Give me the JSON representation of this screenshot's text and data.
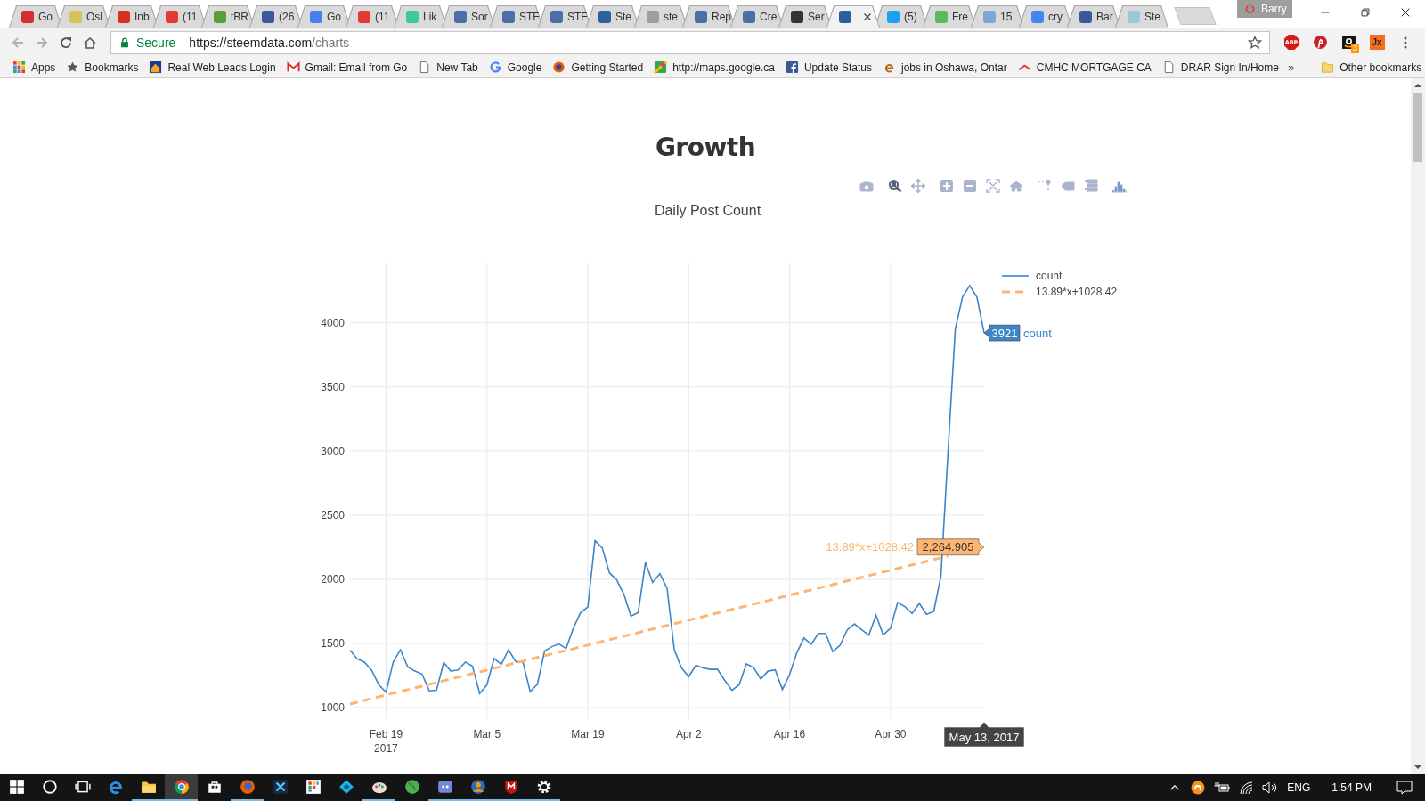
{
  "browser": {
    "tabs": [
      {
        "label": "Go",
        "color": "#d32f2f",
        "selected": false
      },
      {
        "label": "Osl",
        "color": "#d8c25a",
        "selected": false
      },
      {
        "label": "Inb",
        "color": "#d93025",
        "selected": false
      },
      {
        "label": "(11",
        "color": "#e53935",
        "selected": false
      },
      {
        "label": "tBR",
        "color": "#5a9e3a",
        "selected": false
      },
      {
        "label": "(26",
        "color": "#3b5998",
        "selected": false
      },
      {
        "label": "Go",
        "color": "#4a7ef0",
        "selected": false
      },
      {
        "label": "(11",
        "color": "#e53935",
        "selected": false
      },
      {
        "label": "Lik",
        "color": "#3cc8a0",
        "selected": false
      },
      {
        "label": "Sor",
        "color": "#4a6fa5",
        "selected": false
      },
      {
        "label": "STE",
        "color": "#4a6fa5",
        "selected": false
      },
      {
        "label": "STE",
        "color": "#4a6fa5",
        "selected": false
      },
      {
        "label": "Ste",
        "color": "#2c5f9e",
        "selected": false
      },
      {
        "label": "ste",
        "color": "#9e9e9e",
        "selected": false
      },
      {
        "label": "Rep",
        "color": "#4a6fa5",
        "selected": false
      },
      {
        "label": "Cre",
        "color": "#4a6fa5",
        "selected": false
      },
      {
        "label": "Ser",
        "color": "#333333",
        "selected": false
      },
      {
        "color": "#2c5f9e",
        "selected": true
      },
      {
        "label": "(5)",
        "color": "#1da1f2",
        "selected": false
      },
      {
        "label": "Fre",
        "color": "#5cb85c",
        "selected": false
      },
      {
        "label": "15",
        "color": "#7aa7d8",
        "selected": false
      },
      {
        "label": "cry",
        "color": "#4285f4",
        "selected": false
      },
      {
        "label": "Bar",
        "color": "#3b5998",
        "selected": false
      },
      {
        "label": "Ste",
        "color": "#9cc9d9",
        "selected": false
      }
    ],
    "profile": {
      "name": "Barry"
    },
    "address": {
      "secure_label": "Secure",
      "url_host": "https://steemdata.com",
      "url_path": "/charts"
    },
    "extensions": [
      {
        "kind": "abp",
        "text": "ABP"
      },
      {
        "kind": "pinterest"
      },
      {
        "kind": "amazon",
        "badge": "3"
      },
      {
        "kind": "jx",
        "text": "Jx"
      }
    ],
    "bookmarks": [
      {
        "kind": "apps",
        "label": "Apps"
      },
      {
        "kind": "star",
        "label": "Bookmarks"
      },
      {
        "kind": "house",
        "label": "Real Web Leads Login"
      },
      {
        "kind": "gmail",
        "label": "Gmail: Email from Go"
      },
      {
        "kind": "page",
        "label": "New Tab"
      },
      {
        "kind": "google",
        "label": "Google"
      },
      {
        "kind": "firefox",
        "label": "Getting Started"
      },
      {
        "kind": "maps",
        "label": "http://maps.google.ca"
      },
      {
        "kind": "facebook",
        "label": "Update Status"
      },
      {
        "kind": "e",
        "label": "jobs in Oshawa, Ontar"
      },
      {
        "kind": "cmhc",
        "label": "CMHC MORTGAGE CA"
      },
      {
        "kind": "page",
        "label": "DRAR Sign In/Home"
      }
    ],
    "overflow": "»",
    "other_bookmarks": "Other bookmarks"
  },
  "page": {
    "title": "Growth",
    "modebar": [
      {
        "kind": "camera",
        "selected": false
      },
      {
        "kind": "zoom",
        "selected": true
      },
      {
        "kind": "pan",
        "selected": false
      },
      {
        "kind": "zoomin",
        "selected": false
      },
      {
        "kind": "zoomout",
        "selected": false
      },
      {
        "kind": "autoscale",
        "selected": false
      },
      {
        "kind": "home",
        "selected": false
      },
      {
        "kind": "spike",
        "selected": false
      },
      {
        "kind": "closest",
        "selected": false
      },
      {
        "kind": "compare",
        "selected": false
      },
      {
        "kind": "logo",
        "selected": false
      }
    ],
    "chart_data": {
      "type": "line",
      "title": "Daily Post Count",
      "categories": [
        null,
        null,
        null,
        null,
        null,
        "Feb 19",
        null,
        null,
        null,
        null,
        null,
        null,
        null,
        null,
        null,
        null,
        null,
        null,
        null,
        "Mar 5",
        null,
        null,
        null,
        null,
        null,
        null,
        null,
        null,
        null,
        null,
        null,
        null,
        null,
        "Mar 19",
        null,
        null,
        null,
        null,
        null,
        null,
        null,
        null,
        null,
        null,
        null,
        null,
        null,
        "Apr 2",
        null,
        null,
        null,
        null,
        null,
        null,
        null,
        null,
        null,
        null,
        null,
        null,
        null,
        "Apr 16",
        null,
        null,
        null,
        null,
        null,
        null,
        null,
        null,
        null,
        null,
        null,
        null,
        null,
        "Apr 30",
        null,
        null,
        null,
        null,
        null,
        null,
        null,
        null,
        null,
        null,
        null,
        null,
        null
      ],
      "series": [
        {
          "name": "count",
          "color": "#3d85c6",
          "line_style": "solid",
          "values": [
            1447,
            1379,
            1355,
            1291,
            1177,
            1120,
            1355,
            1450,
            1319,
            1284,
            1262,
            1131,
            1135,
            1351,
            1284,
            1294,
            1355,
            1323,
            1110,
            1177,
            1383,
            1337,
            1450,
            1358,
            1355,
            1124,
            1181,
            1440,
            1475,
            1496,
            1461,
            1620,
            1741,
            1784,
            2301,
            2245,
            2050,
            1996,
            1883,
            1713,
            1741,
            2131,
            1975,
            2043,
            1929,
            1450,
            1309,
            1241,
            1330,
            1309,
            1298,
            1298,
            1213,
            1135,
            1177,
            1340,
            1312,
            1223,
            1284,
            1294,
            1142,
            1255,
            1426,
            1543,
            1493,
            1578,
            1578,
            1436,
            1486,
            1606,
            1652,
            1606,
            1564,
            1720,
            1567,
            1617,
            1819,
            1787,
            1734,
            1812,
            1727,
            1748,
            2025,
            3000,
            3950,
            4200,
            4290,
            4200,
            3921
          ]
        },
        {
          "name": "13.89*x+1028.42",
          "color": "#ffb570",
          "line_style": "dashed",
          "values": [
            1028,
            1042,
            1056,
            1070,
            1084,
            1098,
            1112,
            1126,
            1140,
            1153,
            1167,
            1181,
            1195,
            1209,
            1223,
            1237,
            1251,
            1265,
            1278,
            1292,
            1306,
            1320,
            1334,
            1348,
            1362,
            1376,
            1390,
            1404,
            1417,
            1431,
            1445,
            1459,
            1473,
            1487,
            1501,
            1515,
            1529,
            1542,
            1556,
            1570,
            1584,
            1598,
            1612,
            1626,
            1640,
            1654,
            1667,
            1681,
            1695,
            1709,
            1723,
            1737,
            1751,
            1765,
            1779,
            1792,
            1806,
            1820,
            1834,
            1848,
            1862,
            1876,
            1890,
            1904,
            1917,
            1931,
            1945,
            1959,
            1973,
            1987,
            2001,
            2015,
            2029,
            2042,
            2056,
            2070,
            2084,
            2098,
            2112,
            2126,
            2140,
            2154,
            2167,
            2181,
            null,
            null,
            null,
            null,
            null
          ]
        }
      ],
      "grid": true,
      "legend": true,
      "ylim": [
        910,
        4470
      ],
      "yticks": [
        1000,
        1500,
        2000,
        2500,
        3000,
        3500,
        4000
      ]
    },
    "x_axis_year": "2017",
    "hover": {
      "labels": [
        {
          "value": "3921",
          "name": "count"
        },
        {
          "value": "2,264.905",
          "name": "13.89*x+1028.42"
        }
      ],
      "date": "May 13, 2017"
    }
  },
  "taskbar": {
    "items": [
      {
        "kind": "start",
        "running": false,
        "selected": false
      },
      {
        "kind": "search",
        "running": false,
        "selected": false
      },
      {
        "kind": "taskview",
        "running": false,
        "selected": false
      },
      {
        "kind": "edge",
        "running": false,
        "selected": false
      },
      {
        "kind": "explorer",
        "running": true,
        "selected": false
      },
      {
        "kind": "chrome",
        "running": true,
        "selected": true
      },
      {
        "kind": "store",
        "running": false,
        "selected": false
      },
      {
        "kind": "firefox",
        "running": true,
        "selected": false
      },
      {
        "kind": "app",
        "running": false,
        "selected": false
      },
      {
        "kind": "grid",
        "running": false,
        "selected": false
      },
      {
        "kind": "kodi",
        "running": false,
        "selected": false
      },
      {
        "kind": "paint",
        "running": true,
        "selected": false
      },
      {
        "kind": "globe",
        "running": false,
        "selected": false
      },
      {
        "kind": "discord",
        "running": true,
        "selected": false
      },
      {
        "kind": "avatar",
        "running": true,
        "selected": false
      },
      {
        "kind": "shield",
        "running": true,
        "selected": false
      },
      {
        "kind": "settings",
        "running": true,
        "selected": false
      }
    ],
    "tray": {
      "language": "ENG",
      "time": "1:54 PM"
    }
  }
}
